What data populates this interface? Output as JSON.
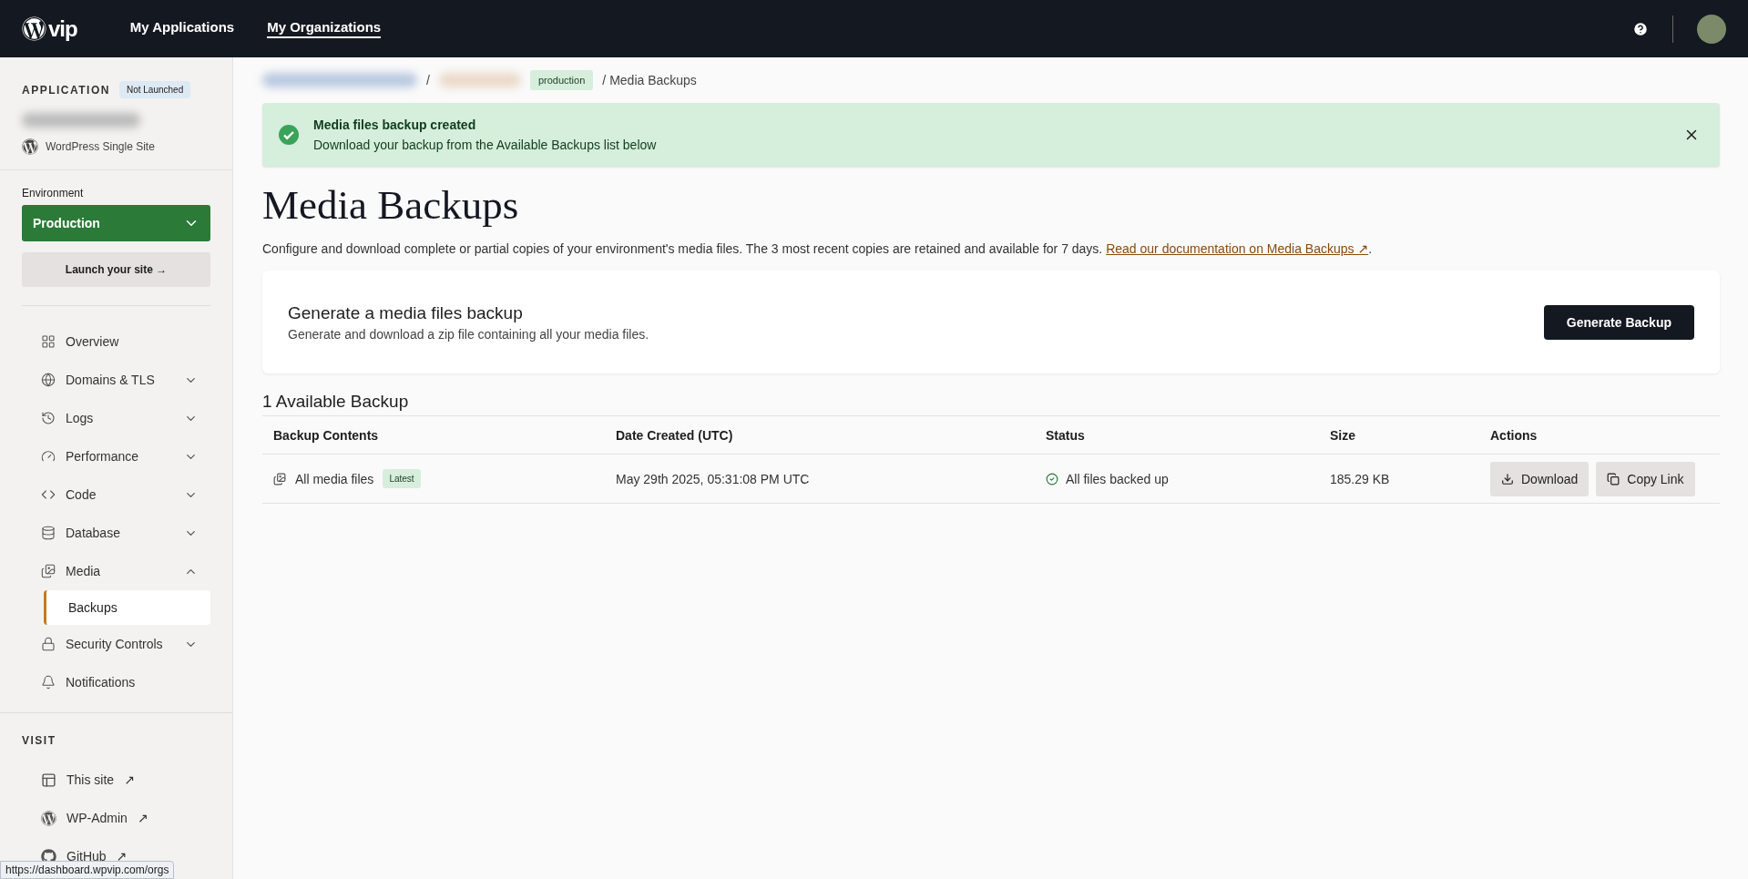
{
  "topbar": {
    "logo": "vip",
    "nav": [
      {
        "label": "My Applications",
        "selected": false
      },
      {
        "label": "My Organizations",
        "selected": true
      }
    ]
  },
  "sidebar": {
    "section_label": "APPLICATION",
    "launch_badge": "Not Launched",
    "app_type": "WordPress Single Site",
    "environment_label": "Environment",
    "environment": "Production",
    "launch_button": "Launch your site →",
    "nav": [
      {
        "label": "Overview",
        "kind": "link",
        "selected": false
      },
      {
        "label": "Domains & TLS",
        "kind": "group",
        "expanded": false,
        "selected": false
      },
      {
        "label": "Logs",
        "kind": "group",
        "expanded": false,
        "selected": false
      },
      {
        "label": "Performance",
        "kind": "group",
        "expanded": false,
        "selected": false
      },
      {
        "label": "Code",
        "kind": "group",
        "expanded": false,
        "selected": false
      },
      {
        "label": "Database",
        "kind": "group",
        "expanded": false,
        "selected": false
      },
      {
        "label": "Media",
        "kind": "group",
        "expanded": true,
        "selected": false,
        "children": [
          {
            "label": "Backups",
            "selected": true
          }
        ]
      },
      {
        "label": "Security Controls",
        "kind": "group",
        "expanded": false,
        "selected": false
      },
      {
        "label": "Notifications",
        "kind": "link",
        "selected": false
      }
    ],
    "visit_label": "VISIT",
    "visit_links": [
      {
        "label": "This site",
        "arrow": "↗"
      },
      {
        "label": "WP-Admin",
        "arrow": "↗"
      },
      {
        "label": "GitHub",
        "arrow": "↗"
      }
    ]
  },
  "breadcrumb": [
    {
      "kind": "redacted",
      "color": "#b9c9e0"
    },
    {
      "kind": "separator",
      "text": "/"
    },
    {
      "kind": "redacted",
      "color": "#ead9c8"
    },
    {
      "kind": "badge",
      "text": "production"
    },
    {
      "kind": "separator",
      "text": "/"
    },
    {
      "kind": "current",
      "text": "Media Backups"
    }
  ],
  "alert": {
    "title": "Media files backup created",
    "message": "Download your backup from the Available Backups list below"
  },
  "page": {
    "title": "Media Backups",
    "description": "Configure and download complete or partial copies of your environment's media files. The 3 most recent copies are retained and available for 7 days.",
    "link": "Read our documentation on Media Backups ↗",
    "after_link": "."
  },
  "card": {
    "title": "Generate a media files backup",
    "subtitle": "Generate and download a zip file containing all your media files.",
    "button": "Generate Backup"
  },
  "table": {
    "title": "1 Available Backup",
    "columns": [
      "Backup Contents",
      "Date Created (UTC)",
      "Status",
      "Size",
      "Actions"
    ],
    "rows": [
      {
        "contents": "All media files",
        "badge": "Latest",
        "date": "May 29th 2025, 05:31:08 PM UTC",
        "status": "All files backed up",
        "size": "185.29 KB",
        "actions": [
          {
            "label": "Download",
            "kind": "download"
          },
          {
            "label": "Copy Link",
            "kind": "copy"
          }
        ]
      }
    ]
  },
  "status_bar": {
    "url": "https://dashboard.wpvip.com/orgs"
  }
}
